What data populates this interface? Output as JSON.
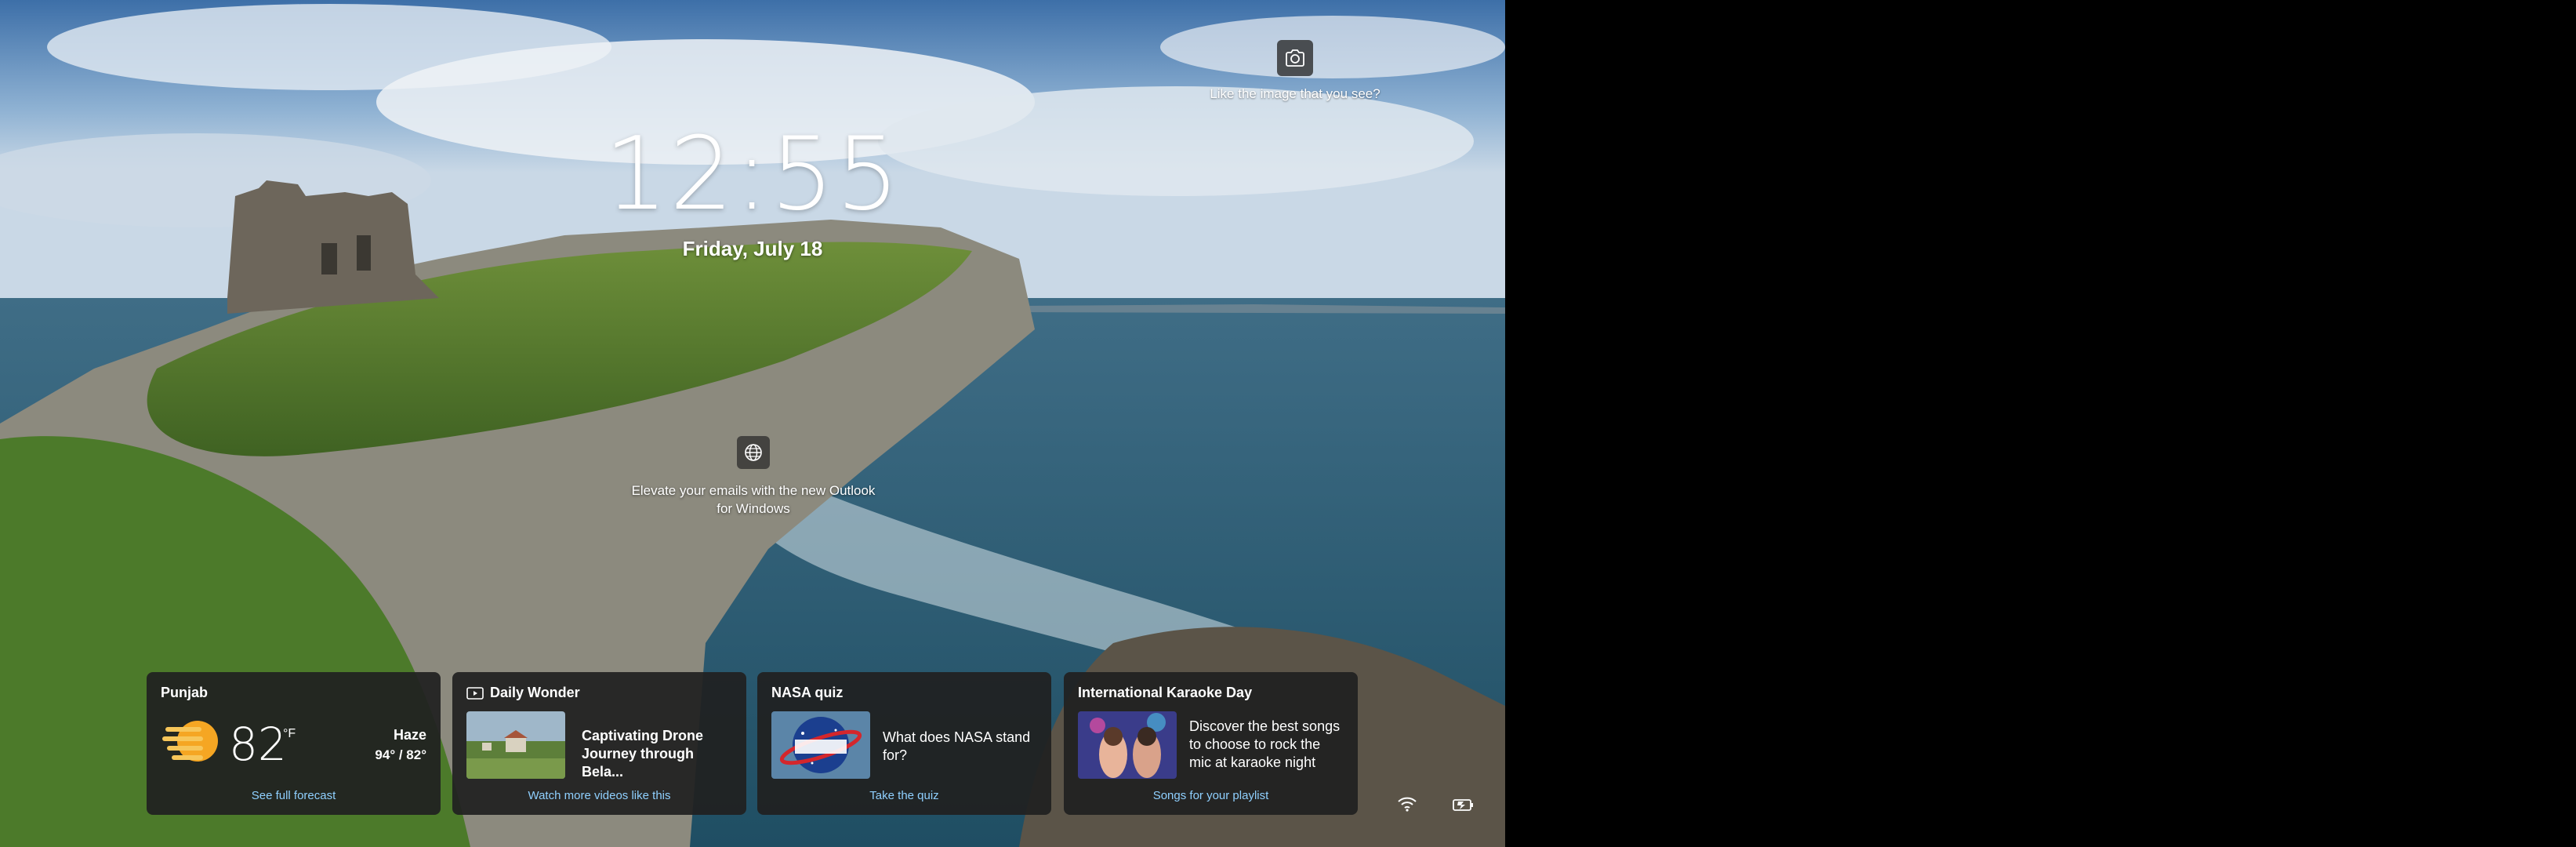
{
  "lockscreen": {
    "camera_caption": "Like the image that you see?",
    "time": "12:55",
    "date": "Friday, July 18",
    "promo_text": "Elevate your emails with the new Outlook for Windows"
  },
  "widgets": [
    {
      "title": "Punjab",
      "temperature": "82",
      "unit": "°F",
      "condition": "Haze",
      "hi_lo": "94° / 82°",
      "link": "See full forecast",
      "icon": "haze-sun-icon"
    },
    {
      "title": "Daily Wonder",
      "body": "Captivating Drone Journey through Bela...",
      "link": "Watch more videos like this",
      "icon": "video-icon"
    },
    {
      "title": "NASA quiz",
      "body": "What does NASA stand for?",
      "link": "Take the quiz"
    },
    {
      "title": "International Karaoke Day",
      "body": "Discover the best songs to choose to rock the mic at karaoke night",
      "link": "Songs for your playlist"
    }
  ],
  "status_icons": [
    "wifi-icon",
    "battery-charging-icon"
  ],
  "colors": {
    "link": "#8fd0ff",
    "card_bg": "#202020",
    "sun": "#f5a623"
  }
}
